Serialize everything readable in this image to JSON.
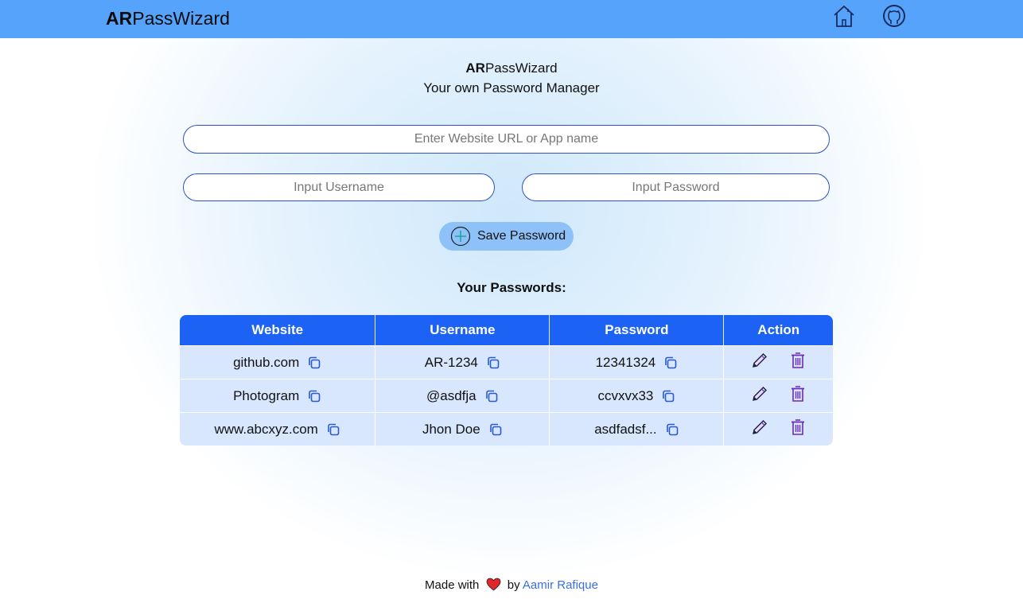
{
  "navbar": {
    "brand_bold": "AR",
    "brand_rest": "PassWizard",
    "icons": [
      "home-icon",
      "github-icon"
    ]
  },
  "header": {
    "title_bold": "AR",
    "title_rest": "PassWizard",
    "subtitle": "Your own Password Manager"
  },
  "form": {
    "url_placeholder": "Enter Website URL or App name",
    "username_placeholder": "Input Username",
    "password_placeholder": "Input Password",
    "save_label": "Save Password"
  },
  "passwords": {
    "heading": "Your Passwords:",
    "columns": [
      "Website",
      "Username",
      "Password",
      "Action"
    ],
    "rows": [
      {
        "website": "github.com",
        "username": "AR-1234",
        "password": "12341324"
      },
      {
        "website": "Photogram",
        "username": "@asdfja",
        "password": "ccvxvx33"
      },
      {
        "website": "www.abcxyz.com",
        "username": "Jhon Doe",
        "password": "asdfadsf..."
      }
    ]
  },
  "footer": {
    "made_with": "Made with",
    "by": "by",
    "author": "Aamir Rafique"
  },
  "colors": {
    "navbar": "#55a3fb",
    "table_header": "#1c63f5",
    "table_row": "#d8e7fd",
    "accent_border": "#2b52c6",
    "button": "#8ec1f8",
    "author_link": "#3b6fe0",
    "heart": "#e0262b"
  }
}
